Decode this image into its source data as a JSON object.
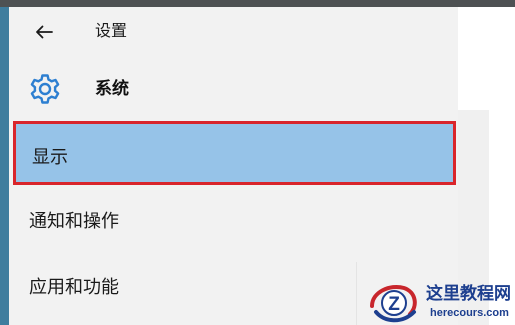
{
  "header": {
    "back_icon": "arrow-left-icon",
    "title": "设置"
  },
  "section": {
    "icon": "gear-icon",
    "title": "系统",
    "accent_color": "#2d7fd1"
  },
  "nav": {
    "items": [
      {
        "label": "显示",
        "selected": true
      },
      {
        "label": "通知和操作",
        "selected": false
      },
      {
        "label": "应用和功能",
        "selected": false
      }
    ],
    "selected_background": "#96c3e8",
    "highlight_border_color": "#d9252b"
  },
  "watermark": {
    "name": "这里教程网",
    "url": "herecours.com",
    "logo_letter": "Z"
  }
}
